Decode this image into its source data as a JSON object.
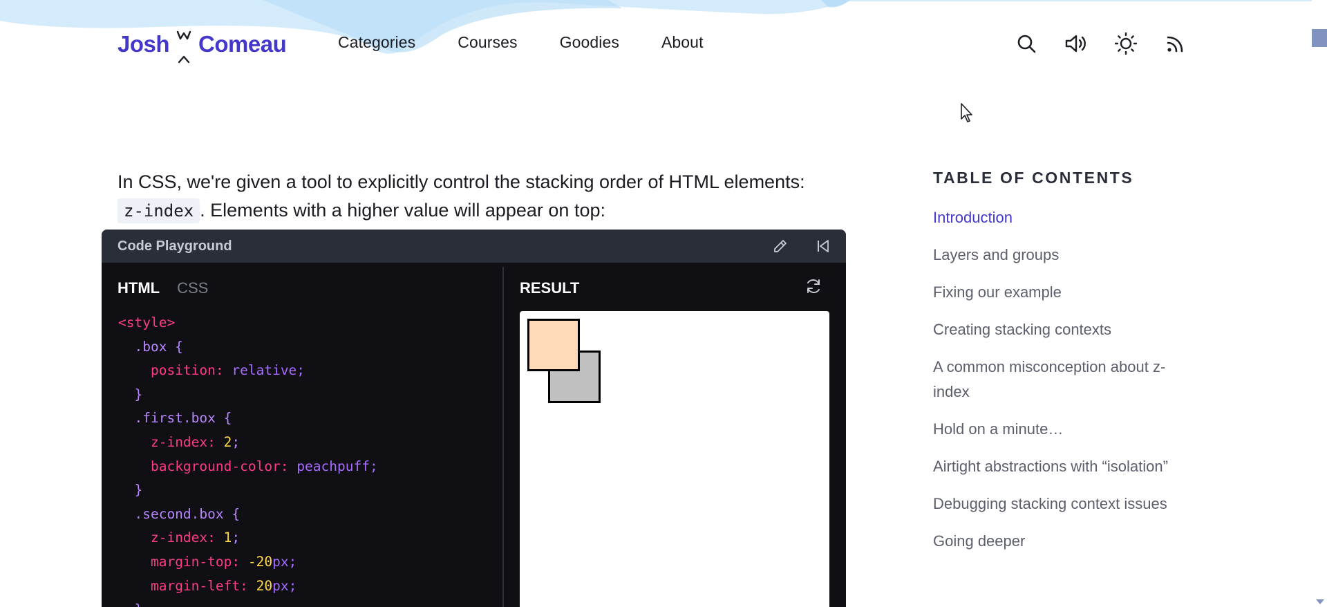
{
  "logo": {
    "first": "Josh",
    "last": "Comeau"
  },
  "nav": [
    {
      "label": "Categories"
    },
    {
      "label": "Courses"
    },
    {
      "label": "Goodies"
    },
    {
      "label": "About"
    }
  ],
  "header_icons": [
    "search-icon",
    "sound-icon",
    "sun-icon",
    "rss-icon"
  ],
  "intro": {
    "before_code": "In CSS, we're given a tool to explicitly control the stacking order of HTML elements: ",
    "code": "z-index",
    "after_code": ". Elements with a higher value will appear on top:"
  },
  "playground": {
    "title": "Code Playground",
    "tabs": {
      "html": "HTML",
      "css": "CSS"
    },
    "result_label": "RESULT",
    "code": {
      "l1_tag": "<style>",
      "l2_sel": ".box {",
      "l3_prop": "position:",
      "l3_val": " relative;",
      "l4_close": "}",
      "l5_sel": ".first.box {",
      "l6_prop": "z-index:",
      "l6_num": " 2",
      "l6_end": ";",
      "l7_prop": "background-color:",
      "l7_val": " peachpuff;",
      "l8_close": "}",
      "l9_sel": ".second.box {",
      "l10_prop": "z-index:",
      "l10_num": " 1",
      "l10_end": ";",
      "l11_prop": "margin-top:",
      "l11_num": " -20",
      "l11_unit": "px;",
      "l12_prop": "margin-left:",
      "l12_num": " 20",
      "l12_unit": "px;",
      "l13_close": "}"
    },
    "result_boxes": {
      "first_color": "#ffdab9",
      "second_color": "#c0c0c0"
    }
  },
  "toc": {
    "heading": "TABLE OF CONTENTS",
    "items": [
      {
        "label": "Introduction",
        "active": true
      },
      {
        "label": "Layers and groups"
      },
      {
        "label": "Fixing our example"
      },
      {
        "label": "Creating stacking contexts"
      },
      {
        "label": "A common misconception about z-index"
      },
      {
        "label": "Hold on a minute…"
      },
      {
        "label": "Airtight abstractions with “isolation”"
      },
      {
        "label": "Debugging stacking context issues"
      },
      {
        "label": "Going deeper"
      }
    ]
  },
  "colors": {
    "brand": "#4338ca",
    "playground_bg": "#101014",
    "playground_header": "#2a2e36"
  }
}
